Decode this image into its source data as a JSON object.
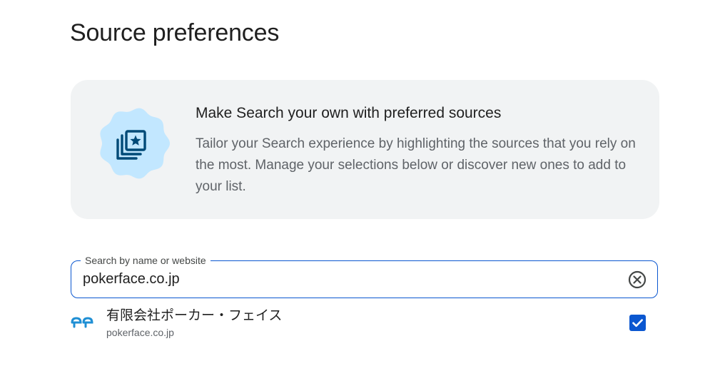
{
  "page": {
    "title": "Source preferences"
  },
  "info_card": {
    "title": "Make Search your own with preferred sources",
    "body": "Tailor your Search experience by highlighting the sources that you rely on the most. Manage your selections below or discover new ones to add to your list.",
    "icon": "star-collection-icon"
  },
  "search": {
    "label": "Search by name or website",
    "value": "pokerface.co.jp",
    "clear_icon": "clear-circle-icon"
  },
  "results": [
    {
      "name": "有限会社ポーカー・フェイス",
      "url": "pokerface.co.jp",
      "favicon": "pp-logo-icon",
      "checked": true
    }
  ],
  "colors": {
    "accent": "#0b57d0",
    "card_background": "#f1f3f4",
    "badge_fill": "#c2e7ff",
    "badge_icon": "#004a77",
    "logo_blue": "#1f8fd4"
  }
}
